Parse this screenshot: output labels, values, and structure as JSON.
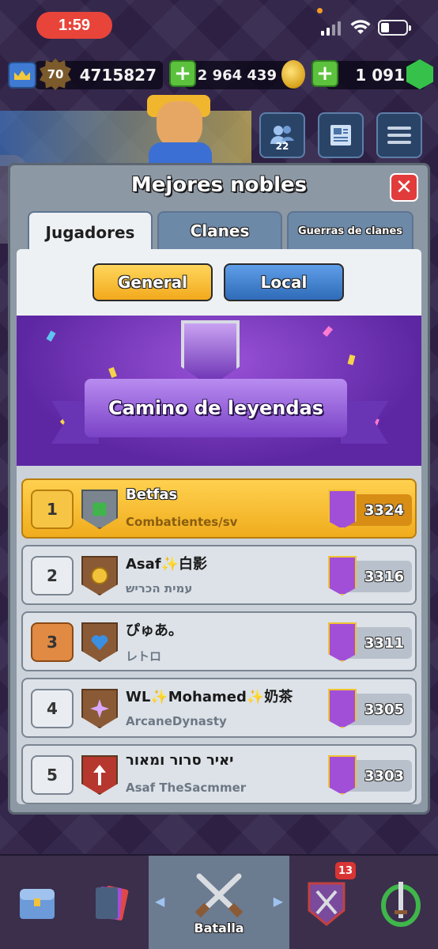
{
  "status_bar": {
    "time": "1:59"
  },
  "resources": {
    "level": "70",
    "trophies": "4715827",
    "gold": "2 964 439",
    "gems": "1 091"
  },
  "social": {
    "friends_count": "22"
  },
  "panel": {
    "title": "Mejores nobles",
    "tabs": [
      {
        "label": "Jugadores",
        "active": true
      },
      {
        "label": "Clanes",
        "active": false
      },
      {
        "label": "Guerras de clanes",
        "active": false
      }
    ],
    "filters": {
      "general": "General",
      "local": "Local"
    },
    "arena_title": "Camino de leyendas"
  },
  "leaderboard": [
    {
      "rank": "1",
      "name": "Betfas",
      "clan": "Combatientes/sv",
      "trophies": "3324",
      "badge_icon": "clover-icon"
    },
    {
      "rank": "2",
      "name": "Asaf✨白影",
      "clan": "עמית הכריש",
      "trophies": "3316",
      "badge_icon": "coin-icon"
    },
    {
      "rank": "3",
      "name": "ぴゅあ。",
      "clan": "レトロ",
      "trophies": "3311",
      "badge_icon": "heart-icon"
    },
    {
      "rank": "4",
      "name": "WL✨Mohamed✨奶茶",
      "clan": "ArcaneDynasty",
      "trophies": "3305",
      "badge_icon": "star-icon"
    },
    {
      "rank": "5",
      "name": "יאיר סרור ומאור",
      "clan": "Asaf TheSacmmer",
      "trophies": "3303",
      "badge_icon": "arrow-icon"
    }
  ],
  "bottom_nav": {
    "battle_label": "Batalla",
    "clan_notification": "13"
  },
  "colors": {
    "accent_gold": "#f2a91c",
    "accent_blue": "#2f6bb8",
    "arena_purple": "#5d27a3",
    "close_red": "#e23b3b"
  }
}
